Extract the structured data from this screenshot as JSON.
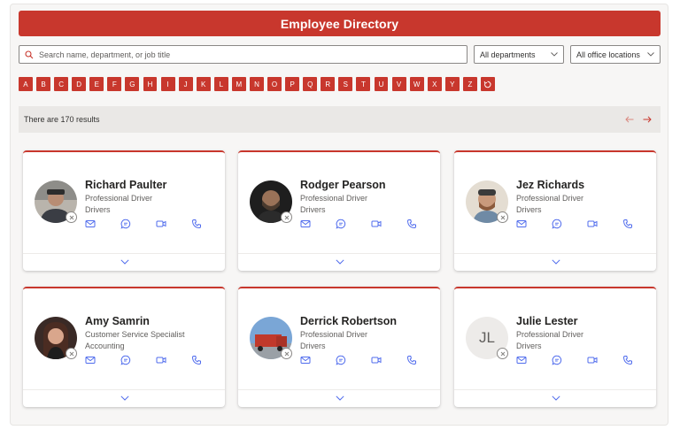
{
  "header": {
    "title": "Employee Directory"
  },
  "search": {
    "placeholder": "Search name, department, or job title"
  },
  "filters": {
    "department": "All departments",
    "location": "All office locations"
  },
  "alphabet": [
    "A",
    "B",
    "C",
    "D",
    "E",
    "F",
    "G",
    "H",
    "I",
    "J",
    "K",
    "L",
    "M",
    "N",
    "O",
    "P",
    "Q",
    "R",
    "S",
    "T",
    "U",
    "V",
    "W",
    "X",
    "Y",
    "Z"
  ],
  "results": {
    "text": "There are 170 results"
  },
  "colors": {
    "accent": "#c8372d",
    "icon": "#4f6bed"
  },
  "icons": {
    "mail": "mail-icon",
    "chat": "chat-icon",
    "video": "video-icon",
    "phone": "phone-icon",
    "expand": "chevron-down-icon",
    "reset": "reset-icon",
    "presence": "presence-offline-icon"
  },
  "employees": [
    {
      "name": "Richard Paulter",
      "role": "Professional Driver",
      "department": "Drivers",
      "initials": ""
    },
    {
      "name": "Rodger Pearson",
      "role": "Professional Driver",
      "department": "Drivers",
      "initials": ""
    },
    {
      "name": "Jez Richards",
      "role": "Professional Driver",
      "department": "Drivers",
      "initials": ""
    },
    {
      "name": "Amy Samrin",
      "role": "Customer Service Specialist",
      "department": "Accounting",
      "initials": ""
    },
    {
      "name": "Derrick Robertson",
      "role": "Professional Driver",
      "department": "Drivers",
      "initials": ""
    },
    {
      "name": "Julie Lester",
      "role": "Professional Driver",
      "department": "Drivers",
      "initials": "JL"
    }
  ]
}
